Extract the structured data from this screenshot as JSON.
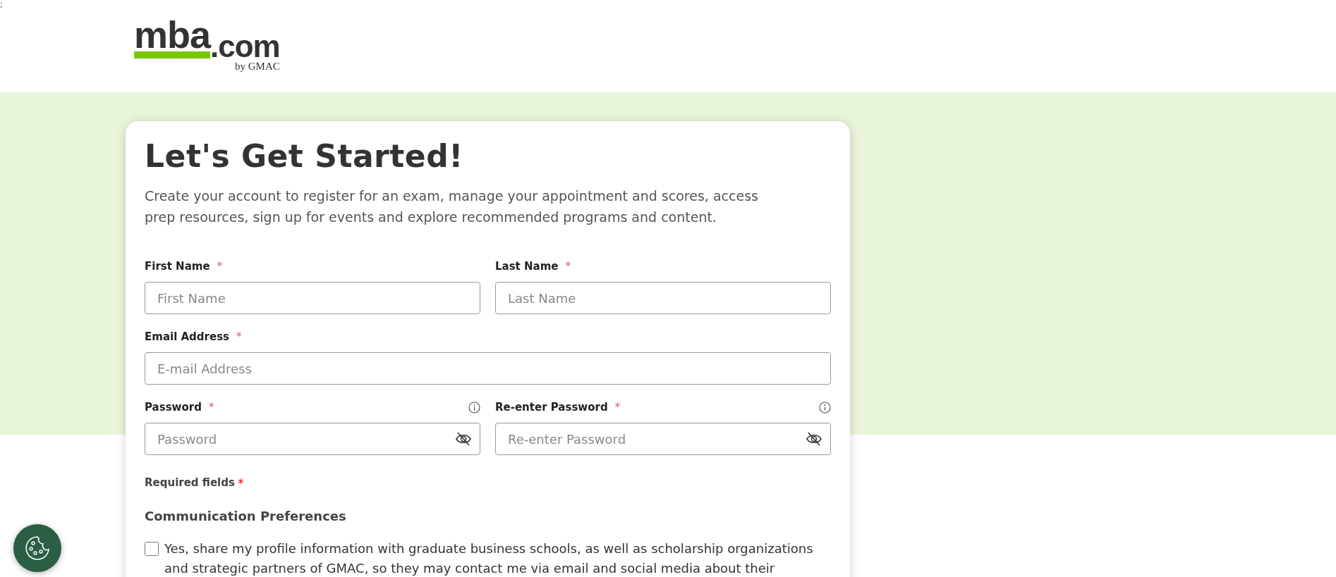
{
  "corner_text": ";",
  "logo": {
    "main": "mba",
    "suffix": ".com",
    "tagline": "by GMAC"
  },
  "form": {
    "title": "Let's Get Started!",
    "description": "Create your account to register for an exam, manage your appointment and scores, access prep resources, sign up for events and explore recommended programs and content.",
    "rows": [
      [
        {
          "label": "First Name",
          "required": true,
          "placeholder": "First Name",
          "info": false,
          "visibility_toggle": false
        },
        {
          "label": "Last Name",
          "required": true,
          "placeholder": "Last Name",
          "info": false,
          "visibility_toggle": false
        }
      ],
      [
        {
          "label": "Email Address",
          "required": true,
          "placeholder": "E-mail Address",
          "info": false,
          "visibility_toggle": false
        }
      ],
      [
        {
          "label": "Password",
          "required": true,
          "placeholder": "Password",
          "info": true,
          "visibility_toggle": true
        },
        {
          "label": "Re-enter Password",
          "required": true,
          "placeholder": "Re-enter Password",
          "info": true,
          "visibility_toggle": true
        }
      ]
    ],
    "required_note": "Required fields",
    "required_mark": "*",
    "section_title": "Communication Preferences",
    "consent": {
      "checked": false,
      "text": "Yes, share my profile information with graduate business schools, as well as scholarship organizations and strategic partners of GMAC, so they may contact me via email and social media about their"
    }
  }
}
